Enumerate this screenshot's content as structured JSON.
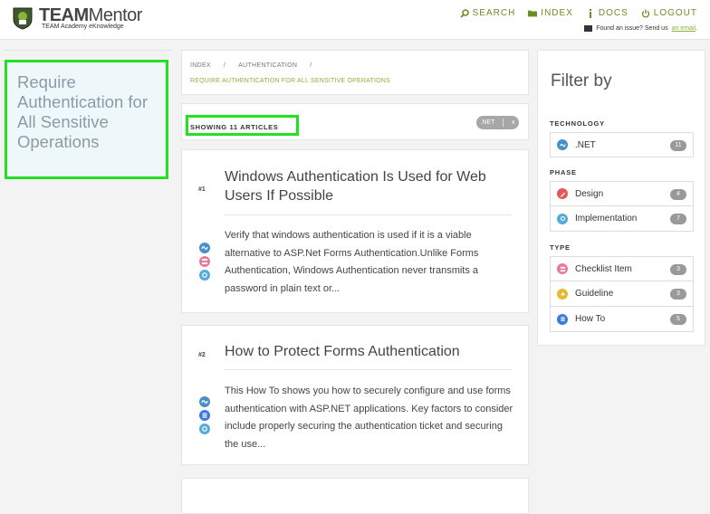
{
  "header": {
    "logo_brand": "TEAM",
    "logo_product": "Mentor",
    "logo_tagline": "TEAM Academy eKnowledge",
    "nav": [
      {
        "label": "SEARCH",
        "icon": "search-icon"
      },
      {
        "label": "INDEX",
        "icon": "folder-icon"
      },
      {
        "label": "DOCS",
        "icon": "info-icon"
      },
      {
        "label": "LOGOUT",
        "icon": "power-icon"
      }
    ],
    "issue_text": "Found an issue? Send us",
    "issue_link": "an email",
    "issue_suffix": "."
  },
  "page": {
    "title": "Require Authentication for All Sensitive Operations"
  },
  "breadcrumb": {
    "items": [
      "INDEX",
      "/",
      "AUTHENTICATION",
      "/"
    ],
    "current": "REQUIRE AUTHENTICATION FOR ALL SENSITIVE OPERATIONS"
  },
  "results": {
    "showing_label": "SHOWING 11 ARTICLES",
    "active_filter": ".NET",
    "remove_label": "x"
  },
  "articles": [
    {
      "number": "#1",
      "title": "Windows Authentication Is Used for Web Users If Possible",
      "summary": "Verify that windows authentication is used if it is a viable alternative to ASP.Net Forms Authentication.Unlike Forms Authentication, Windows Authentication never transmits a password in plain text or...",
      "icons": [
        "dotnet-icon",
        "checklist-icon",
        "implementation-icon"
      ]
    },
    {
      "number": "#2",
      "title": "How to Protect Forms Authentication",
      "summary": "This How To shows you how to securely configure and use forms authentication with ASP.NET applications. Key factors to consider include properly securing the authentication ticket and securing the use...",
      "icons": [
        "dotnet-icon",
        "howto-icon",
        "implementation-icon"
      ]
    }
  ],
  "filter": {
    "title": "Filter by",
    "sections": [
      {
        "heading": "TECHNOLOGY",
        "items": [
          {
            "label": ".NET",
            "count": "11",
            "icon": "dotnet-icon",
            "color": "#4a90c8"
          }
        ]
      },
      {
        "heading": "PHASE",
        "items": [
          {
            "label": "Design",
            "count": "4",
            "icon": "design-icon",
            "color": "#e05a5a"
          },
          {
            "label": "Implementation",
            "count": "7",
            "icon": "implementation-icon",
            "color": "#55aadd"
          }
        ]
      },
      {
        "heading": "TYPE",
        "items": [
          {
            "label": "Checklist Item",
            "count": "3",
            "icon": "checklist-icon",
            "color": "#e87a9a"
          },
          {
            "label": "Guideline",
            "count": "3",
            "icon": "guideline-icon",
            "color": "#e8b830"
          },
          {
            "label": "How To",
            "count": "5",
            "icon": "howto-icon",
            "color": "#3a7ad8"
          }
        ]
      }
    ]
  },
  "colors": {
    "accent": "#8ab43a",
    "highlight_border": "#22e022"
  }
}
